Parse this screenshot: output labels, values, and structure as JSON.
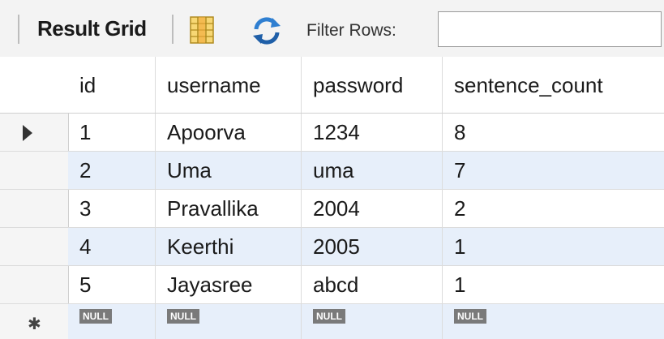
{
  "toolbar": {
    "title": "Result Grid",
    "filter_label": "Filter Rows:",
    "filter_value": "",
    "grid_icon": "form-editor-icon",
    "refresh_icon": "refresh-icon"
  },
  "grid": {
    "columns": [
      "id",
      "username",
      "password",
      "sentence_count"
    ],
    "rows": [
      {
        "id": "1",
        "username": "Apoorva",
        "password": "1234",
        "sentence_count": "8"
      },
      {
        "id": "2",
        "username": "Uma",
        "password": "uma",
        "sentence_count": "7"
      },
      {
        "id": "3",
        "username": "Pravallika",
        "password": "2004",
        "sentence_count": "2"
      },
      {
        "id": "4",
        "username": "Keerthi",
        "password": "2005",
        "sentence_count": "1"
      },
      {
        "id": "5",
        "username": "Jayasree",
        "password": "abcd",
        "sentence_count": "1"
      }
    ],
    "new_row": {
      "id": "NULL",
      "username": "NULL",
      "password": "NULL",
      "sentence_count": "NULL"
    },
    "current_row_marker": "▶",
    "new_row_marker": "✱"
  },
  "colors": {
    "alt_row": "#e7effa",
    "null_badge": "#7a7a7a",
    "toolbar_bg": "#f3f3f3"
  }
}
